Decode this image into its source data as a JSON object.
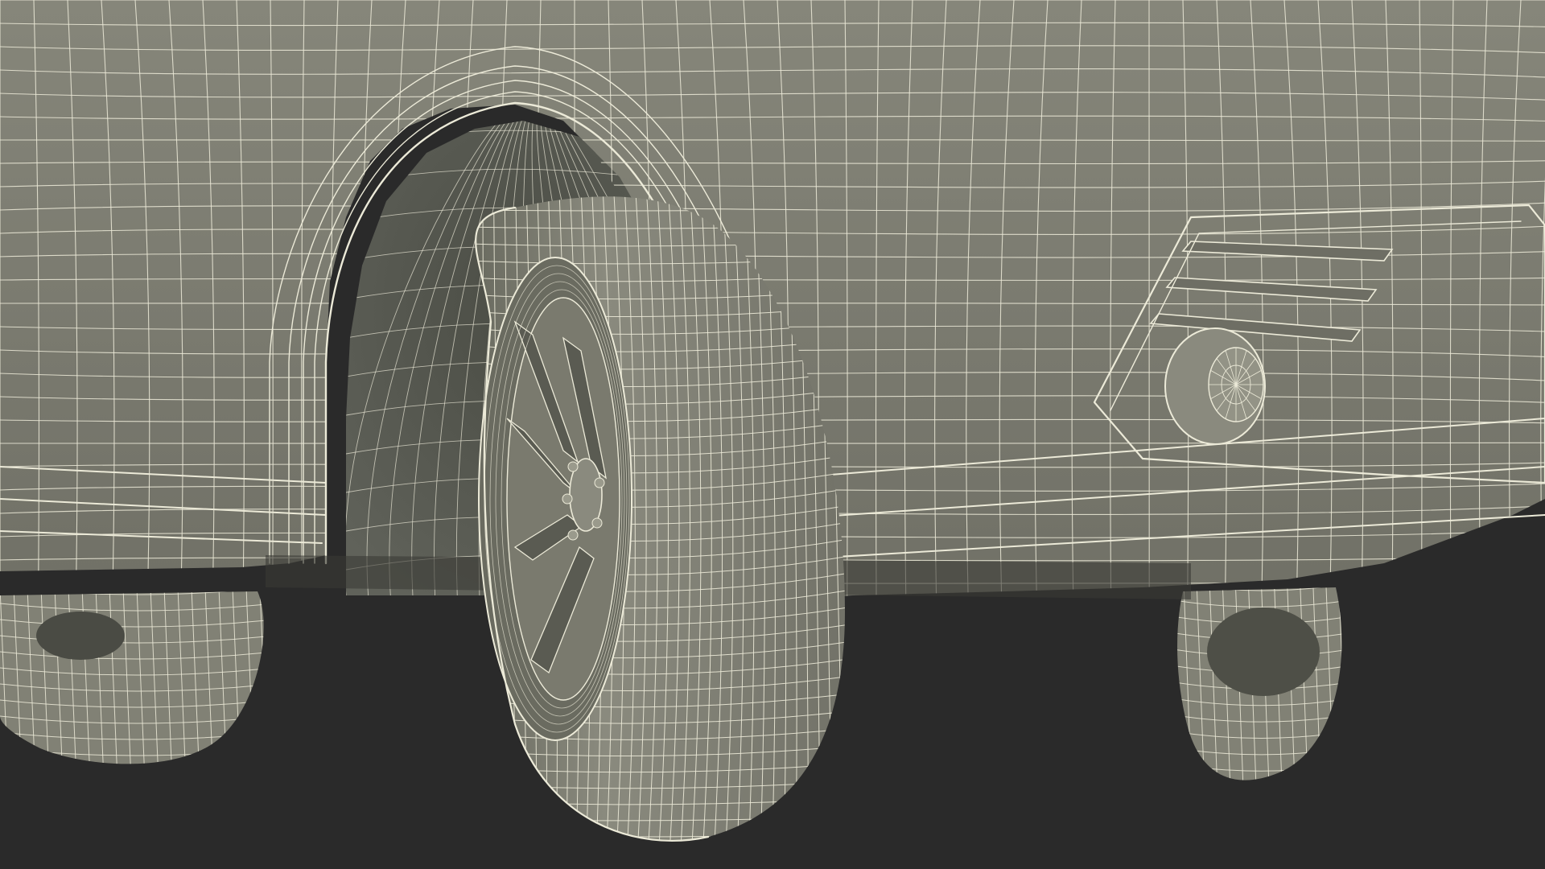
{
  "scene": {
    "background_color": "#2a2a2a",
    "surface_color": "#7c7c70",
    "surface_dark_color": "#585a50",
    "tire_color": "#818175",
    "wire_color": "#ecead8",
    "render_mode": "wireframe-on-shaded"
  }
}
